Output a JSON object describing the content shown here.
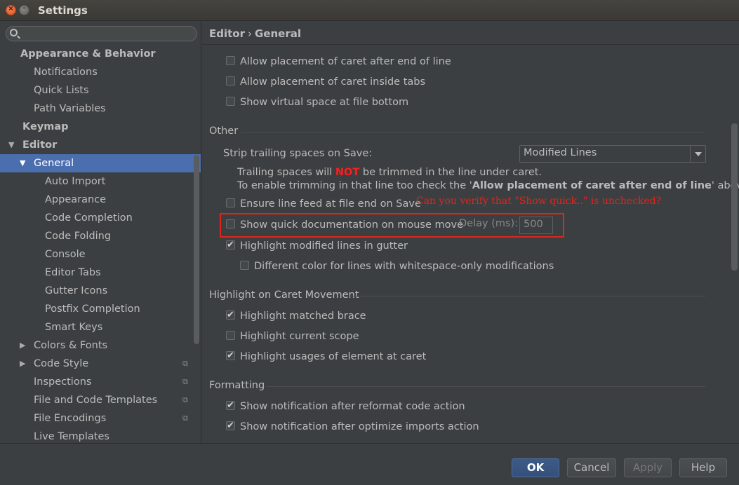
{
  "window": {
    "title": "Settings",
    "close_glyph": "×",
    "min_glyph": "–"
  },
  "sidebar": {
    "search_placeholder": "",
    "items": [
      {
        "label": "Appearance & Behavior",
        "level": 0,
        "bold": true
      },
      {
        "label": "Notifications",
        "level": 1
      },
      {
        "label": "Quick Lists",
        "level": 1
      },
      {
        "label": "Path Variables",
        "level": 1
      },
      {
        "label": "Keymap",
        "level": 0,
        "bold": true
      },
      {
        "label": "Editor",
        "level": 0,
        "bold": true,
        "expanded": true
      },
      {
        "label": "General",
        "level": 1,
        "expanded": true,
        "selected": true
      },
      {
        "label": "Auto Import",
        "level": 2
      },
      {
        "label": "Appearance",
        "level": 2
      },
      {
        "label": "Code Completion",
        "level": 2
      },
      {
        "label": "Code Folding",
        "level": 2
      },
      {
        "label": "Console",
        "level": 2
      },
      {
        "label": "Editor Tabs",
        "level": 2
      },
      {
        "label": "Gutter Icons",
        "level": 2
      },
      {
        "label": "Postfix Completion",
        "level": 2
      },
      {
        "label": "Smart Keys",
        "level": 2
      },
      {
        "label": "Colors & Fonts",
        "level": 1,
        "collapsed": true
      },
      {
        "label": "Code Style",
        "level": 1,
        "collapsed": true,
        "project_icon": true
      },
      {
        "label": "Inspections",
        "level": 1,
        "project_icon": true
      },
      {
        "label": "File and Code Templates",
        "level": 1,
        "project_icon": true
      },
      {
        "label": "File Encodings",
        "level": 1,
        "project_icon": true
      },
      {
        "label": "Live Templates",
        "level": 1
      }
    ]
  },
  "breadcrumb": {
    "parent": "Editor",
    "separator": "›",
    "current": "General"
  },
  "scroll_group": {
    "allow_caret_after_end": {
      "label": "Allow placement of caret after end of line",
      "checked": false
    },
    "allow_caret_inside_tabs": {
      "label": "Allow placement of caret inside tabs",
      "checked": false
    },
    "virtual_space_bottom": {
      "label": "Show virtual space at file bottom",
      "checked": false
    }
  },
  "other": {
    "section_title": "Other",
    "strip_label": "Strip trailing spaces on Save:",
    "strip_value": "Modified Lines",
    "info_1_pre": "Trailing spaces will ",
    "info_1_not": "NOT",
    "info_1_post": " be trimmed in the line under caret.",
    "info_2_pre": "To enable trimming in that line too check the '",
    "info_2_bold": "Allow placement of caret after end of line",
    "info_2_post": "' above.",
    "ensure_line_feed": {
      "label": "Ensure line feed at file end on Save",
      "checked": false
    },
    "show_quick_doc": {
      "label": "Show quick documentation on mouse move",
      "checked": false
    },
    "delay_label": "Delay (ms):",
    "delay_value": "500",
    "highlight_modified": {
      "label": "Highlight modified lines in gutter",
      "checked": true
    },
    "different_color": {
      "label": "Different color for lines with whitespace-only modifications",
      "checked": false
    }
  },
  "annotation": {
    "text": "Can you verify that \"Show quick..\" is unchecked?",
    "color": "#e0251c"
  },
  "caret_movement": {
    "section_title": "Highlight on Caret Movement",
    "matched_brace": {
      "label": "Highlight matched brace",
      "checked": true
    },
    "current_scope": {
      "label": "Highlight current scope",
      "checked": false
    },
    "usages": {
      "label": "Highlight usages of element at caret",
      "checked": true
    }
  },
  "formatting": {
    "section_title": "Formatting",
    "reformat_notify": {
      "label": "Show notification after reformat code action",
      "checked": true
    },
    "optimize_notify": {
      "label": "Show notification after optimize imports action",
      "checked": true
    }
  },
  "buttons": {
    "ok": "OK",
    "cancel": "Cancel",
    "apply": "Apply",
    "help": "Help"
  },
  "colors": {
    "selection": "#4b6eaf",
    "background": "#3c3f41",
    "annotation_red": "#e0251c",
    "ok_button": "#365880"
  }
}
